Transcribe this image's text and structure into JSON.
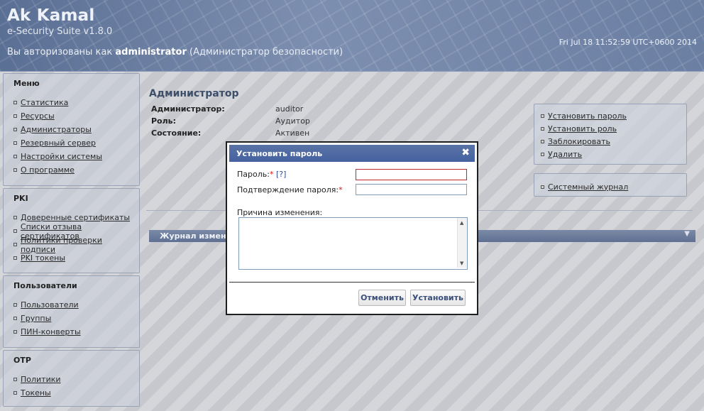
{
  "header": {
    "title": "Ak Kamal",
    "subtitle": "e-Security Suite v1.8.0",
    "auth_prefix": "Вы авторизованы как ",
    "auth_user": "administrator",
    "auth_role": " (Администратор безопасности)",
    "datetime": "Fri Jul 18 11:52:59 UTC+0600 2014"
  },
  "sidebar": {
    "menu": {
      "title": "Меню",
      "items": [
        "Статистика",
        "Ресурсы",
        "Администраторы",
        "Резервный сервер",
        "Настройки системы",
        "О программе"
      ]
    },
    "pki": {
      "title": "PKI",
      "items": [
        "Доверенные сертификаты",
        "Списки отзыва сертификатов",
        "Политики проверки подписи",
        "PKI токены"
      ]
    },
    "users": {
      "title": "Пользователи",
      "items": [
        "Пользователи",
        "Группы",
        "ПИН-конверты"
      ]
    },
    "otp": {
      "title": "OTP",
      "items": [
        "Политики",
        "Токены"
      ]
    }
  },
  "main": {
    "title": "Администратор",
    "props": [
      {
        "key": "Администратор:",
        "value": "auditor"
      },
      {
        "key": "Роль:",
        "value": "Аудитор"
      },
      {
        "key": "Состояние:",
        "value": "Активен"
      }
    ],
    "actions": [
      "Установить пароль",
      "Установить роль",
      "Заблокировать",
      "Удалить"
    ],
    "actions2": [
      "Системный журнал"
    ],
    "journal_title": "Журнал изменен"
  },
  "modal": {
    "title": "Установить пароль",
    "password_label": "Пароль:",
    "required_mark": "*",
    "help": "[?]",
    "confirm_label": "Подтверждение пароля:",
    "reason_label": "Причина изменения:",
    "password_value": "",
    "confirm_value": "",
    "reason_value": "",
    "cancel": "Отменить",
    "submit": "Установить"
  },
  "colors": {
    "header_blue": "#5d7296",
    "modal_header": "#4562a0",
    "required": "#d11111",
    "error_border": "#c0272d"
  }
}
